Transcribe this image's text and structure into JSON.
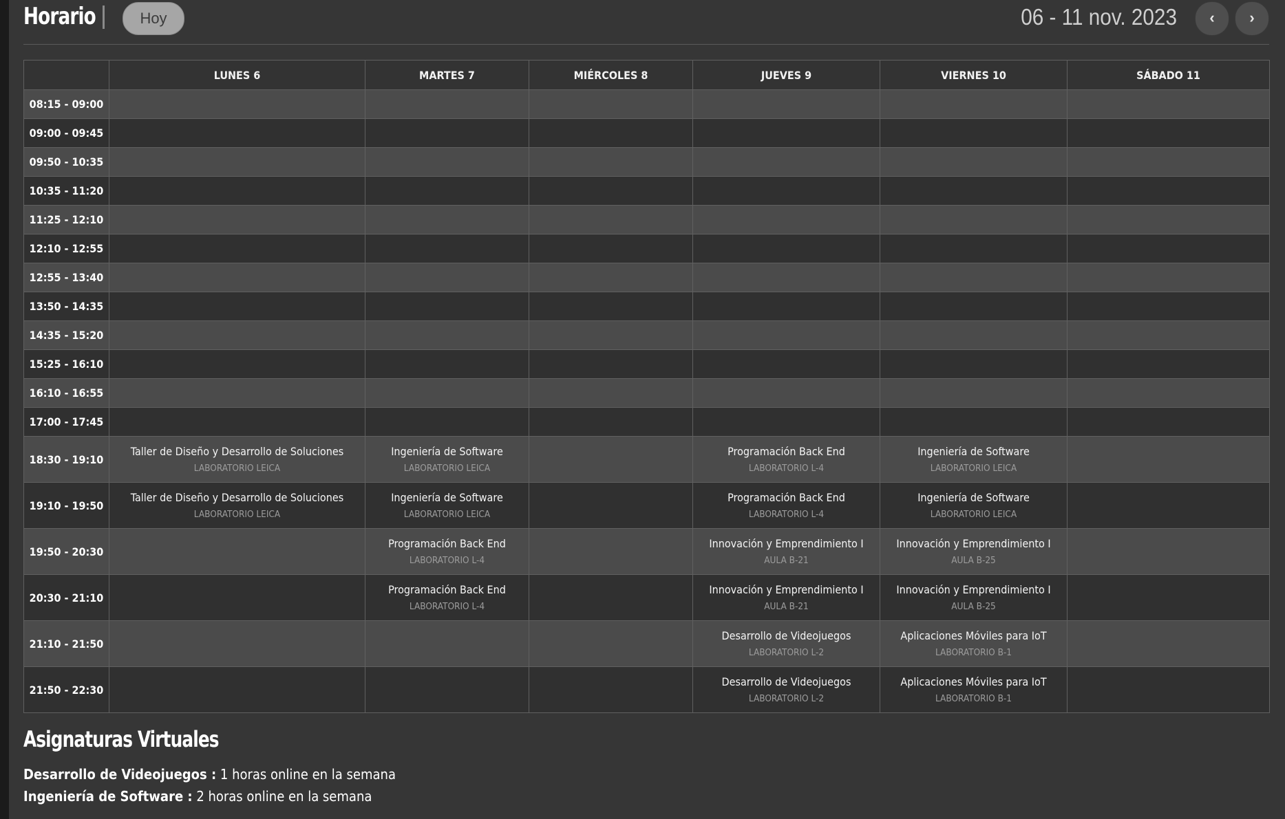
{
  "header": {
    "title": "Horario",
    "today_label": "Hoy",
    "date_range": "06 - 11 nov. 2023",
    "prev_label": "‹",
    "next_label": "›"
  },
  "days": [
    "LUNES 6",
    "MARTES 7",
    "MIÉRCOLES 8",
    "JUEVES 9",
    "VIERNES 10",
    "SÁBADO 11"
  ],
  "slots": [
    {
      "time": "08:15 - 09:00",
      "cells": [
        null,
        null,
        null,
        null,
        null,
        null
      ]
    },
    {
      "time": "09:00 - 09:45",
      "cells": [
        null,
        null,
        null,
        null,
        null,
        null
      ]
    },
    {
      "time": "09:50 - 10:35",
      "cells": [
        null,
        null,
        null,
        null,
        null,
        null
      ]
    },
    {
      "time": "10:35 - 11:20",
      "cells": [
        null,
        null,
        null,
        null,
        null,
        null
      ]
    },
    {
      "time": "11:25 - 12:10",
      "cells": [
        null,
        null,
        null,
        null,
        null,
        null
      ]
    },
    {
      "time": "12:10 - 12:55",
      "cells": [
        null,
        null,
        null,
        null,
        null,
        null
      ]
    },
    {
      "time": "12:55 - 13:40",
      "cells": [
        null,
        null,
        null,
        null,
        null,
        null
      ]
    },
    {
      "time": "13:50 - 14:35",
      "cells": [
        null,
        null,
        null,
        null,
        null,
        null
      ]
    },
    {
      "time": "14:35 - 15:20",
      "cells": [
        null,
        null,
        null,
        null,
        null,
        null
      ]
    },
    {
      "time": "15:25 - 16:10",
      "cells": [
        null,
        null,
        null,
        null,
        null,
        null
      ]
    },
    {
      "time": "16:10 - 16:55",
      "cells": [
        null,
        null,
        null,
        null,
        null,
        null
      ]
    },
    {
      "time": "17:00 - 17:45",
      "cells": [
        null,
        null,
        null,
        null,
        null,
        null
      ]
    },
    {
      "time": "18:30 - 19:10",
      "cells": [
        {
          "course": "Taller de Diseño y Desarrollo de Soluciones",
          "room": "LABORATORIO LEICA"
        },
        {
          "course": "Ingeniería de Software",
          "room": "LABORATORIO LEICA"
        },
        null,
        {
          "course": "Programación Back End",
          "room": "LABORATORIO L-4"
        },
        {
          "course": "Ingeniería de Software",
          "room": "LABORATORIO LEICA"
        },
        null
      ]
    },
    {
      "time": "19:10 - 19:50",
      "cells": [
        {
          "course": "Taller de Diseño y Desarrollo de Soluciones",
          "room": "LABORATORIO LEICA"
        },
        {
          "course": "Ingeniería de Software",
          "room": "LABORATORIO LEICA"
        },
        null,
        {
          "course": "Programación Back End",
          "room": "LABORATORIO L-4"
        },
        {
          "course": "Ingeniería de Software",
          "room": "LABORATORIO LEICA"
        },
        null
      ]
    },
    {
      "time": "19:50 - 20:30",
      "cells": [
        null,
        {
          "course": "Programación Back End",
          "room": "LABORATORIO L-4"
        },
        null,
        {
          "course": "Innovación y Emprendimiento I",
          "room": "AULA B-21"
        },
        {
          "course": "Innovación y Emprendimiento I",
          "room": "AULA B-25"
        },
        null
      ]
    },
    {
      "time": "20:30 - 21:10",
      "cells": [
        null,
        {
          "course": "Programación Back End",
          "room": "LABORATORIO L-4"
        },
        null,
        {
          "course": "Innovación y Emprendimiento I",
          "room": "AULA B-21"
        },
        {
          "course": "Innovación y Emprendimiento I",
          "room": "AULA B-25"
        },
        null
      ]
    },
    {
      "time": "21:10 - 21:50",
      "cells": [
        null,
        null,
        null,
        {
          "course": "Desarrollo de Videojuegos",
          "room": "LABORATORIO L-2"
        },
        {
          "course": "Aplicaciones Móviles para IoT",
          "room": "LABORATORIO B-1"
        },
        null
      ]
    },
    {
      "time": "21:50 - 22:30",
      "cells": [
        null,
        null,
        null,
        {
          "course": "Desarrollo de Videojuegos",
          "room": "LABORATORIO L-2"
        },
        {
          "course": "Aplicaciones Móviles para IoT",
          "room": "LABORATORIO B-1"
        },
        null
      ]
    }
  ],
  "virtual": {
    "title": "Asignaturas Virtuales",
    "items": [
      {
        "name": "Desarrollo de Videojuegos :",
        "detail": " 1 horas online en la semana"
      },
      {
        "name": "Ingeniería de Software :",
        "detail": " 2 horas online en la semana"
      }
    ]
  },
  "colors": {
    "background": "#363636",
    "row_light": "#4b4b4b",
    "row_dark": "#303030",
    "room_text": "#9c9c9c",
    "today_button": "#a6a6a6"
  }
}
